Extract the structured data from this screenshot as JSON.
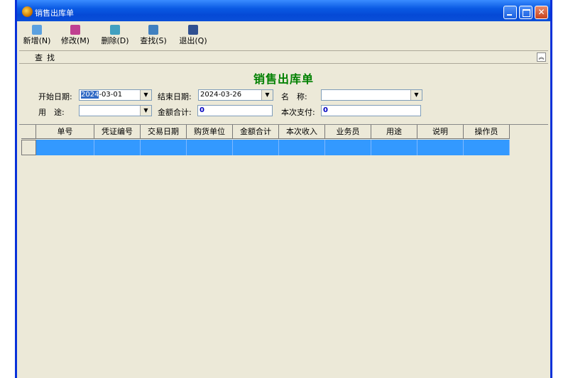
{
  "window": {
    "title": "销售出库单"
  },
  "toolbar": [
    {
      "label": "新增(N)",
      "icon": "add-icon",
      "color": "#5aa0e0"
    },
    {
      "label": "修改(M)",
      "icon": "edit-icon",
      "color": "#c04090"
    },
    {
      "label": "删除(D)",
      "icon": "delete-icon",
      "color": "#40a0c0"
    },
    {
      "label": "查找(S)",
      "icon": "find-icon",
      "color": "#4080c0"
    },
    {
      "label": "退出(Q)",
      "icon": "exit-icon",
      "color": "#305090"
    }
  ],
  "search_bar": {
    "label": "查找"
  },
  "form": {
    "title": "销售出库单",
    "start_date_label": "开始日期:",
    "start_date_sel": "2024",
    "start_date_rest": "-03-01",
    "end_date_label": "结束日期:",
    "end_date": "2024-03-26",
    "name_label": "名　称:",
    "name_value": "",
    "purpose_label": "用　途:",
    "purpose_value": "",
    "total_label": "金额合计:",
    "total_value": "0",
    "payment_label": "本次支付:",
    "payment_value": "0"
  },
  "table": {
    "columns": [
      "单号",
      "凭证编号",
      "交易日期",
      "购货单位",
      "金额合计",
      "本次收入",
      "业务员",
      "用途",
      "说明",
      "操作员"
    ],
    "rows": [
      [
        "",
        "",
        "",
        "",
        "",
        "",
        "",
        "",
        "",
        ""
      ]
    ]
  },
  "colors": {
    "titlebar": "#0a5ae3",
    "form_title": "#008000",
    "selected_row": "#3399ff"
  }
}
